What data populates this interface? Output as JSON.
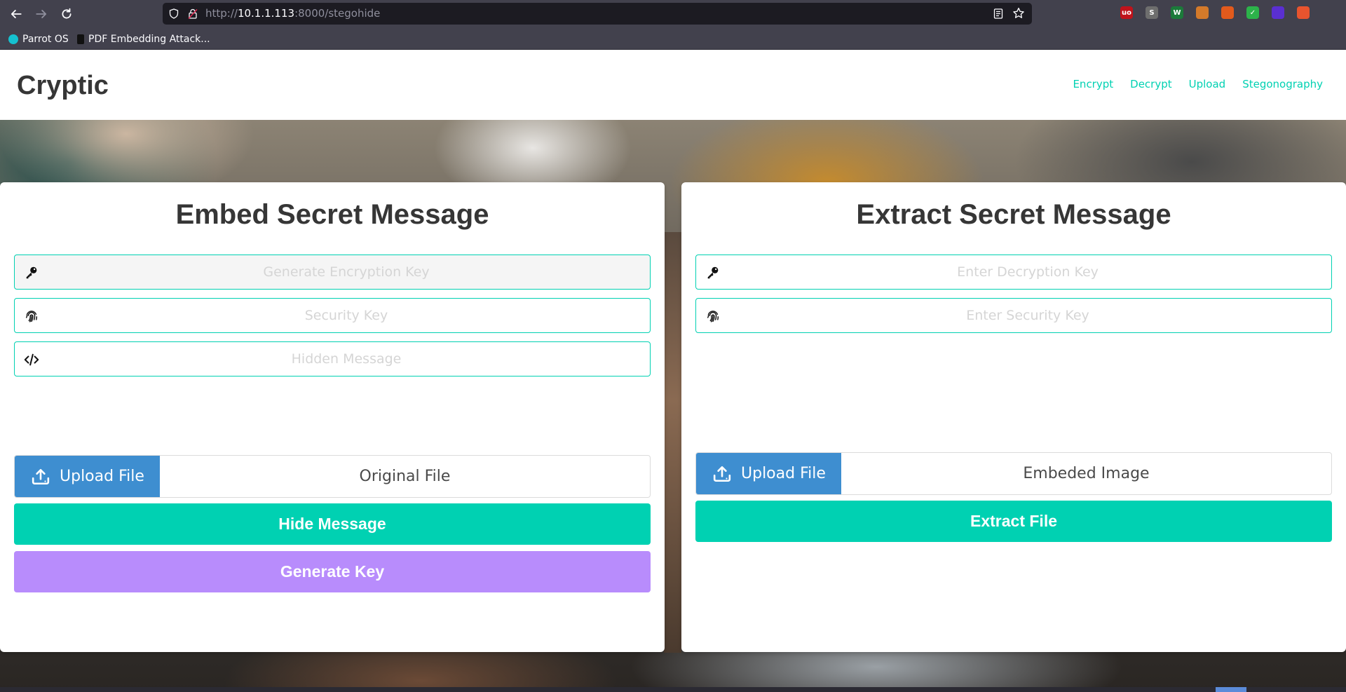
{
  "browser": {
    "url_prefix": "http://",
    "url_host": "10.1.1.113",
    "url_rest": ":8000/stegohide",
    "extensions": [
      {
        "icon": "ublock-icon",
        "label": "uo",
        "color": "#c0131b"
      },
      {
        "icon": "notes-icon",
        "label": "S",
        "color": "#6e6e6e"
      },
      {
        "icon": "wappalyzer-icon",
        "label": "W",
        "color": "#1c7a3a"
      },
      {
        "icon": "cookie-icon",
        "label": "",
        "color": "#d47a2a"
      },
      {
        "icon": "foxy-icon",
        "label": "",
        "color": "#e25a1c"
      },
      {
        "icon": "check-icon",
        "label": "✓",
        "color": "#2cb34a"
      },
      {
        "icon": "gem-icon",
        "label": "",
        "color": "#5a2fd1"
      },
      {
        "icon": "burp-icon",
        "label": "",
        "color": "#e8542e"
      }
    ]
  },
  "bookmarks": [
    {
      "label": "Parrot OS",
      "color": "#15c1d0"
    },
    {
      "label": "PDF Embedding Attack...",
      "color": "#111111"
    }
  ],
  "site": {
    "brand": "Cryptic",
    "nav": [
      "Encrypt",
      "Decrypt",
      "Upload",
      "Stegonography"
    ]
  },
  "embed": {
    "title": "Embed Secret Message",
    "encryption_key_placeholder": "Generate Encryption Key",
    "security_key_placeholder": "Security Key",
    "hidden_message_placeholder": "Hidden Message",
    "upload_label": "Upload File",
    "file_name": "Original File",
    "hide_button": "Hide Message",
    "generate_button": "Generate Key"
  },
  "extract": {
    "title": "Extract Secret Message",
    "decryption_key_placeholder": "Enter Decryption Key",
    "security_key_placeholder": "Enter Security Key",
    "upload_label": "Upload File",
    "file_name": "Embeded Image",
    "extract_button": "Extract File"
  },
  "colors": {
    "accent": "#00d1b2",
    "info": "#3e8ed0",
    "purple": "#b88cfc"
  }
}
